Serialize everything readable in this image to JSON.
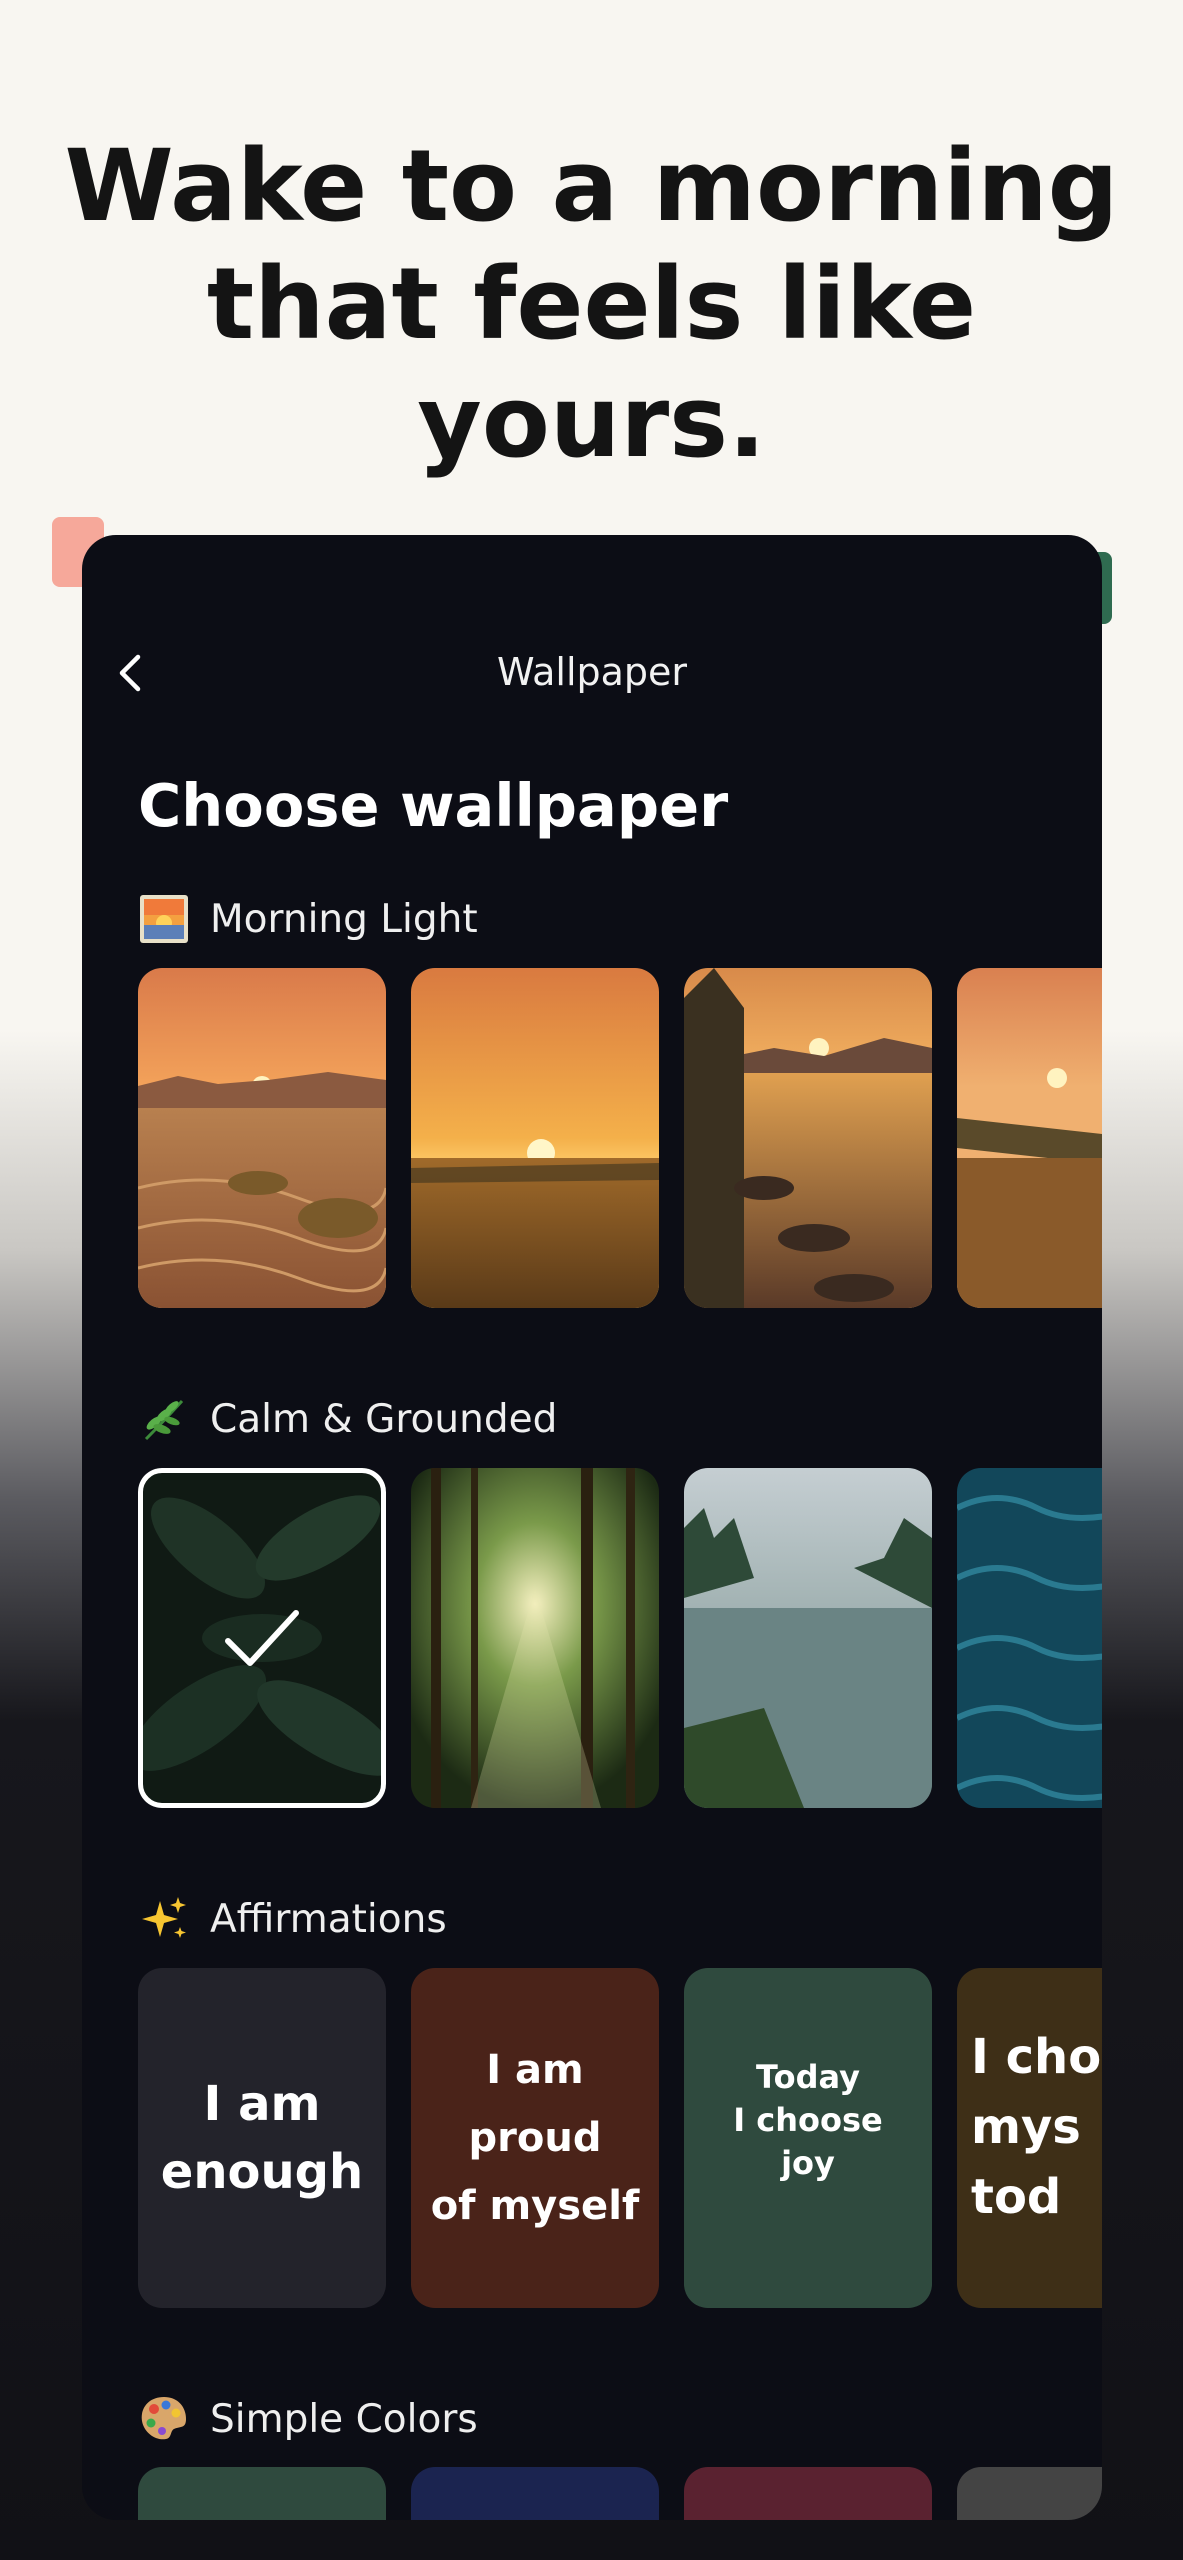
{
  "headline": {
    "line1": "Wake to a morning",
    "line2": "that feels like",
    "line3": "yours."
  },
  "nav": {
    "back_icon": "chevron-left-icon",
    "title": "Wallpaper"
  },
  "page_title": "Choose wallpaper",
  "sections": [
    {
      "label": "Morning Light",
      "icon": "sunrise-picture-icon"
    },
    {
      "label": "Calm & Grounded",
      "icon": "herb-leaf-icon"
    },
    {
      "label": "Affirmations",
      "icon": "sparkles-icon"
    },
    {
      "label": "Simple Colors",
      "icon": "artist-palette-icon"
    }
  ],
  "morning_light": [
    {
      "name": "sunset-desert-dunes"
    },
    {
      "name": "sunrise-golden-field"
    },
    {
      "name": "sunset-rocky-lake"
    },
    {
      "name": "sunrise-misty-meadow"
    }
  ],
  "calm_grounded": [
    {
      "name": "dark-leaves",
      "selected": true
    },
    {
      "name": "sunlit-forest"
    },
    {
      "name": "misty-mountain-lake"
    },
    {
      "name": "ocean-waves"
    }
  ],
  "affirmations": [
    {
      "text": "I am\nenough",
      "bg": "#23232b"
    },
    {
      "text": "I am\nproud\nof myself",
      "bg": "#4a2319"
    },
    {
      "text": "Today\nI choose\njoy",
      "bg": "#2f4a3e"
    },
    {
      "text": "I cho\nmys\ntod",
      "bg": "#3e2f17"
    }
  ],
  "simple_colors": [
    "#2f4a3e",
    "#1b2450",
    "#5a2230",
    "#444444"
  ],
  "colors": {
    "page_bg": "#f8f6f1",
    "phone_bg": "#0c0d15",
    "headline": "#141414",
    "accent_coral": "#f6a89a",
    "accent_green": "#2f6b50"
  }
}
